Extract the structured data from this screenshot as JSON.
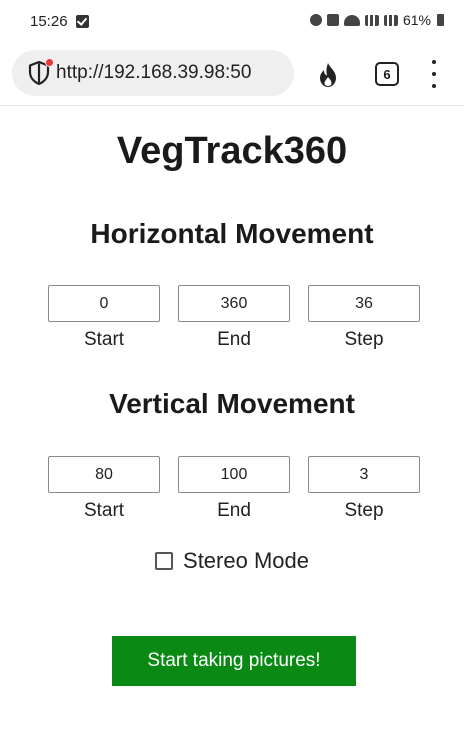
{
  "status_bar": {
    "time": "15:26",
    "battery": "61%"
  },
  "browser": {
    "url": "http://192.168.39.98:50",
    "tab_count": "6"
  },
  "page": {
    "title": "VegTrack360",
    "horizontal": {
      "heading": "Horizontal Movement",
      "start_value": "0",
      "end_value": "360",
      "step_value": "36",
      "start_label": "Start",
      "end_label": "End",
      "step_label": "Step"
    },
    "vertical": {
      "heading": "Vertical Movement",
      "start_value": "80",
      "end_value": "100",
      "step_value": "3",
      "start_label": "Start",
      "end_label": "End",
      "step_label": "Step"
    },
    "stereo_mode_label": "Stereo Mode",
    "stereo_mode_checked": false,
    "start_button_label": "Start taking pictures!"
  },
  "colors": {
    "button_bg": "#0a8a14",
    "button_text": "#ffffff",
    "shield_badge": "#e53935"
  }
}
